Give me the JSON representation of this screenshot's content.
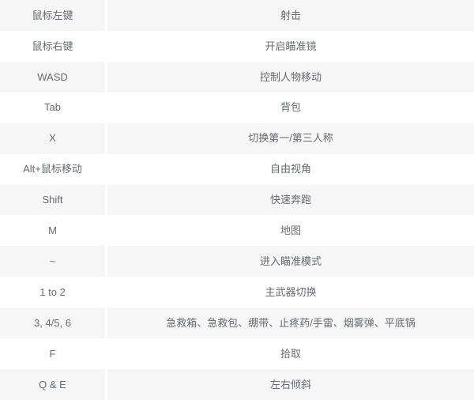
{
  "table": {
    "row_count": 13,
    "columns": [
      "key",
      "action"
    ],
    "colors": {
      "row_odd_background": "#f6f6f6",
      "row_even_background": "#ffffff",
      "text": "#666a70",
      "page_background": "#ffffff"
    },
    "rows": [
      {
        "key": "鼠标左键",
        "action": "射击"
      },
      {
        "key": "鼠标右键",
        "action": "开启瞄准镜"
      },
      {
        "key": "WASD",
        "action": "控制人物移动"
      },
      {
        "key": "Tab",
        "action": "背包"
      },
      {
        "key": "X",
        "action": "切换第一/第三人称"
      },
      {
        "key": "Alt+鼠标移动",
        "action": "自由视角"
      },
      {
        "key": "Shift",
        "action": "快速奔跑"
      },
      {
        "key": "M",
        "action": "地图"
      },
      {
        "key": "~",
        "action": "进入瞄准模式"
      },
      {
        "key": "1 to 2",
        "action": "主武器切换"
      },
      {
        "key": "3, 4/5, 6",
        "action": "急救箱、急救包、绷带、止疼药/手雷、烟雾弹、平底锅"
      },
      {
        "key": "F",
        "action": "拾取"
      },
      {
        "key": "Q & E",
        "action": "左右倾斜"
      }
    ]
  }
}
